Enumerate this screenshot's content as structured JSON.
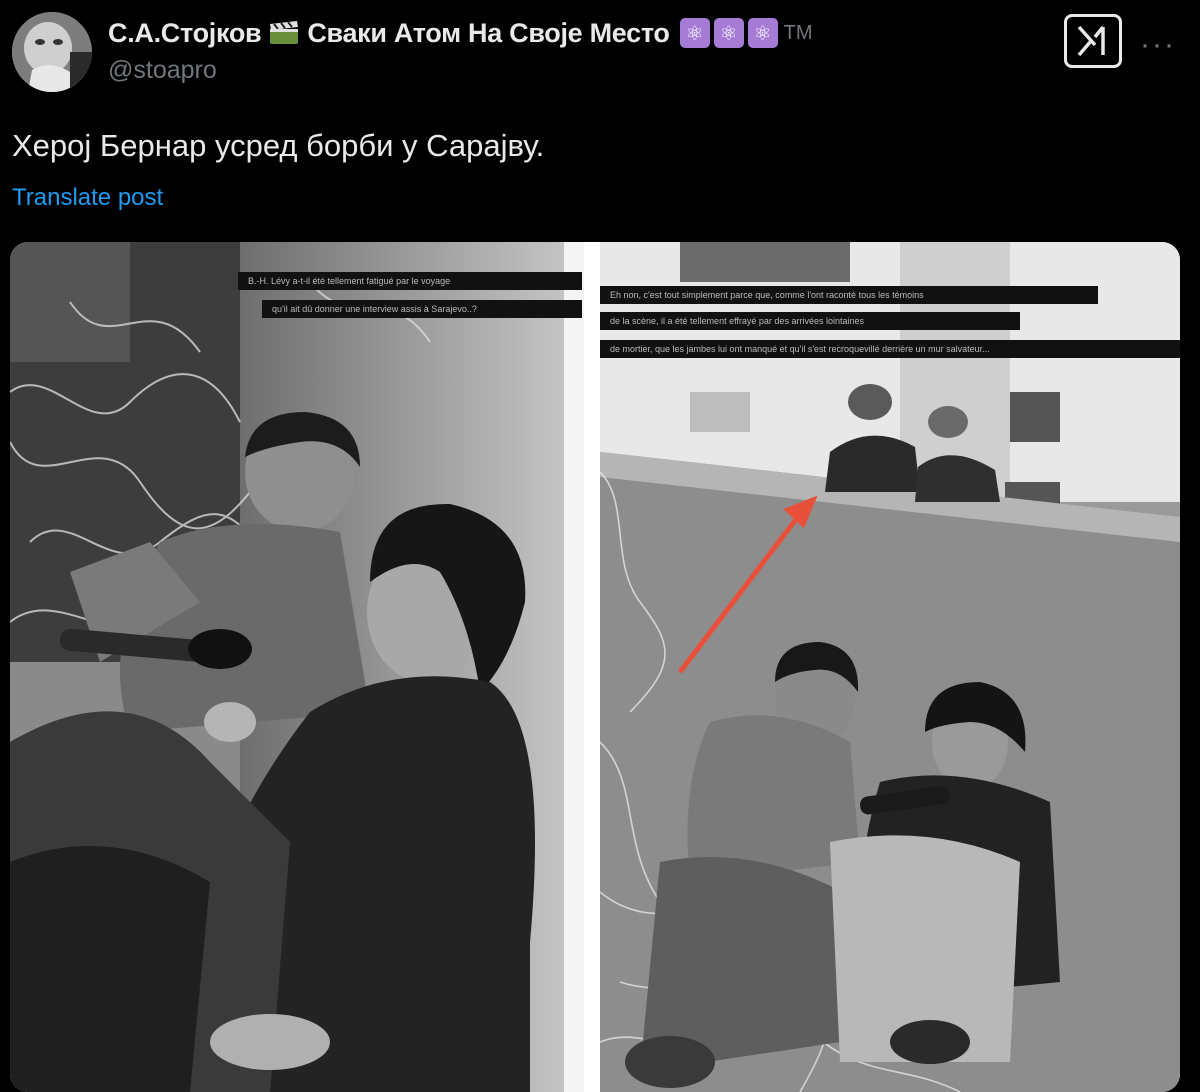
{
  "post": {
    "author": {
      "display_name": "С.А.Стојков",
      "name_suffix": "Сваки Атом На Своје Место",
      "tm": "TM",
      "handle": "@stoapro",
      "emoji_icons": [
        "clapper-board-icon",
        "atom-icon",
        "atom-icon",
        "atom-icon"
      ]
    },
    "text": "Херој Бернар усред борби у Сарајву.",
    "translate_label": "Translate post",
    "more_label": "···"
  },
  "media": {
    "left_captions": [
      "B.-H. Lévy a-t-il été tellement fatigué par le voyage",
      "qu'il ait dû donner une interview assis à Sarajevo..?"
    ],
    "right_captions": [
      "Eh non, c'est tout simplement parce que, comme l'ont raconté tous les témoins",
      "de la scène, il a été tellement effrayé par des arrivées lointaines",
      "de mortier, que les jambes lui ont manqué et qu'il s'est recroquevillé derrière un mur salvateur..."
    ]
  },
  "colors": {
    "background": "#000000",
    "text_primary": "#e7e9ea",
    "text_secondary": "#71767b",
    "link": "#1d9bf0",
    "atom_badge": "#a57bd6",
    "arrow": "#e8503a"
  }
}
